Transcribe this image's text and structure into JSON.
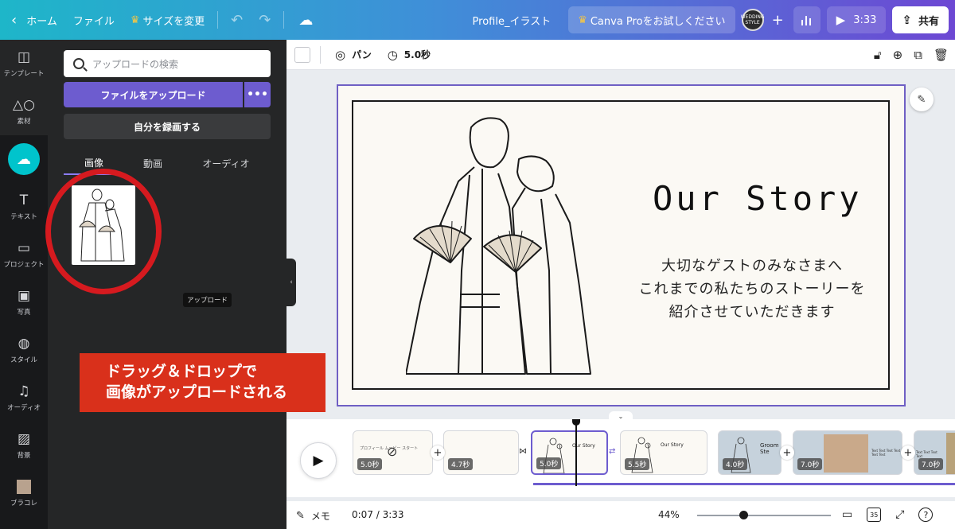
{
  "topbar": {
    "home": "ホーム",
    "file": "ファイル",
    "resize": "サイズを変更",
    "title": "Profile_イラスト",
    "pro": "Canva Proをお試しください",
    "avatar_text": "WEDDING STYLE",
    "duration": "3:33",
    "share": "共有"
  },
  "rail": [
    {
      "icon": "template-icon",
      "label": "テンプレート"
    },
    {
      "icon": "elements-icon",
      "label": "素材"
    },
    {
      "icon": "upload-icon",
      "label": ""
    },
    {
      "icon": "text-icon",
      "label": "テキスト"
    },
    {
      "icon": "folder-icon",
      "label": "プロジェクト"
    },
    {
      "icon": "photo-icon",
      "label": "写真"
    },
    {
      "icon": "palette-icon",
      "label": "スタイル"
    },
    {
      "icon": "music-icon",
      "label": "オーディオ"
    },
    {
      "icon": "background-icon",
      "label": "背景"
    },
    {
      "icon": "brand-icon",
      "label": "ブラコレ"
    }
  ],
  "panel": {
    "search_placeholder": "アップロードの検索",
    "upload_button": "ファイルをアップロード",
    "more": "•••",
    "record_button": "自分を録画する",
    "tabs": [
      "画像",
      "動画",
      "オーディオ"
    ],
    "tooltip": "アップロード"
  },
  "annotation": {
    "line1": "ドラッグ＆ドロップで",
    "line2": "画像がアップロードされる"
  },
  "editbar": {
    "pan": "パン",
    "duration": "5.0秒"
  },
  "canvas": {
    "title": "Our Story",
    "body_line1": "大切なゲストのみなさまへ",
    "body_line2": "これまでの私たちのストーリーを",
    "body_line3": "紹介させていただきます"
  },
  "timeline": {
    "slides": [
      {
        "duration": "5.0秒"
      },
      {
        "duration": "4.7秒"
      },
      {
        "duration": "5.0秒"
      },
      {
        "duration": "5.5秒"
      },
      {
        "duration": "4.0秒"
      },
      {
        "duration": "7.0秒"
      },
      {
        "duration": "7.0秒"
      }
    ],
    "slide_mini_title": "Our Story",
    "slide1_text": "プロフィール ムービー スタート",
    "slide5_text": "Groom Ste",
    "slide6_text": "Text Text Text Text Text Text",
    "slide7_text": "Text Text Text Text"
  },
  "statusbar": {
    "memo": "メモ",
    "time": "0:07 / 3:33",
    "zoom": "44%",
    "zoom_level": 0.35,
    "pages": "35",
    "help": "?"
  }
}
